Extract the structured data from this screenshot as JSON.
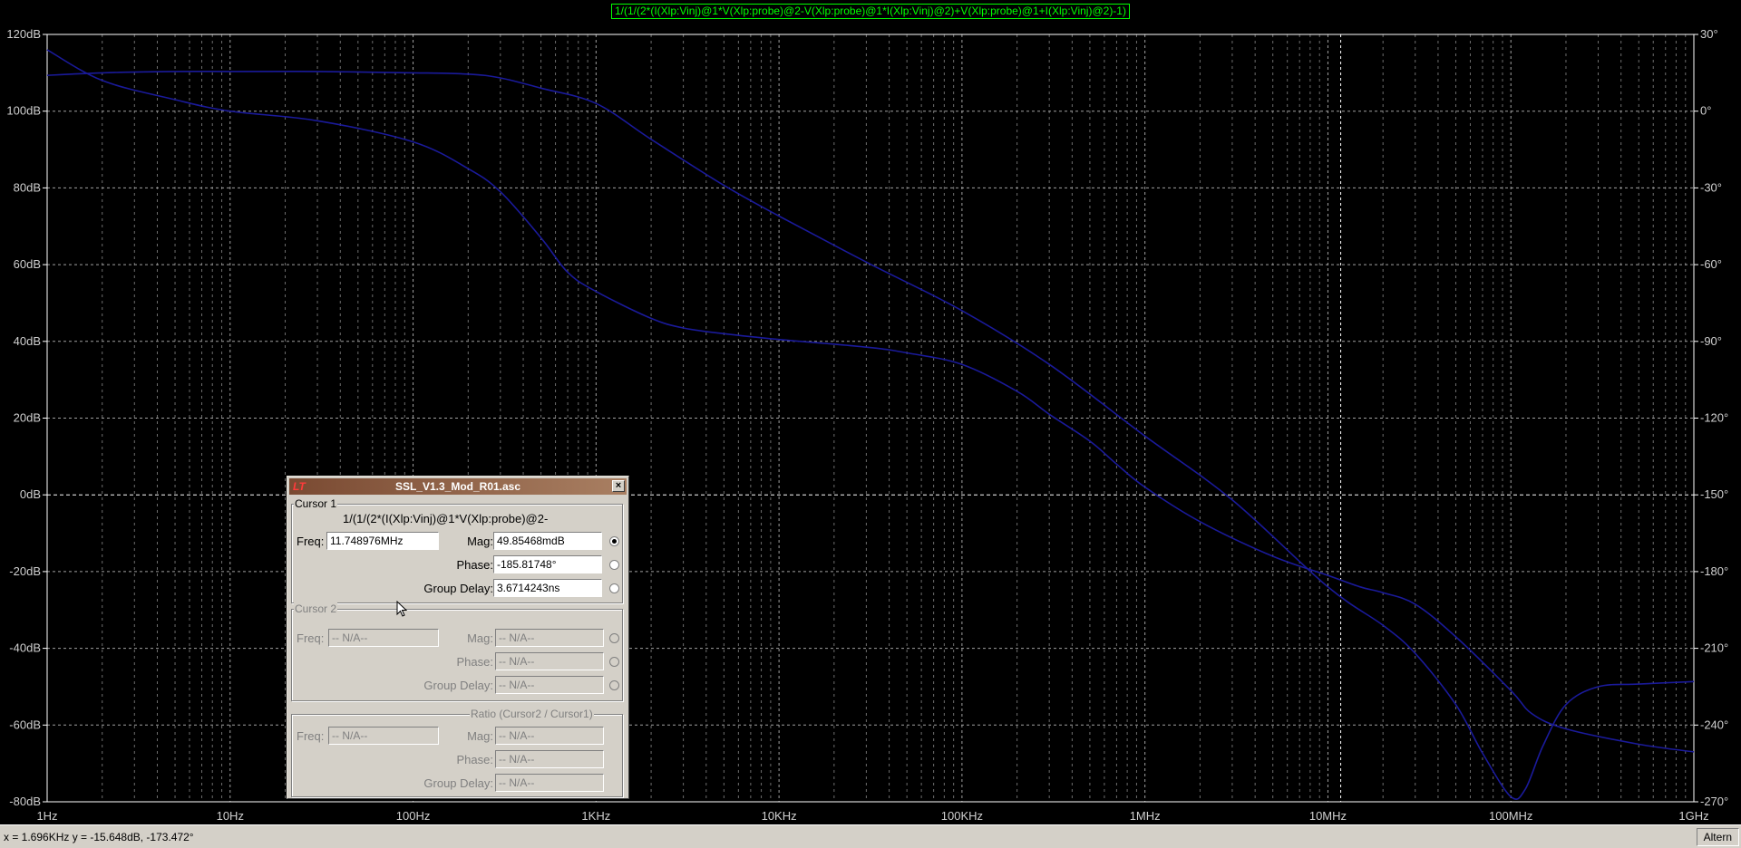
{
  "window": {
    "trace_expression": "1/(1/(2*(I(Xlp:Vinj)@1*V(Xlp:probe)@2-V(Xlp:probe)@1*I(Xlp:Vinj)@2)+V(Xlp:probe)@1+I(Xlp:Vinj)@2)-1)"
  },
  "chart_data": {
    "type": "line",
    "title": "1/(1/(2*(I(Xlp:Vinj)@1*V(Xlp:probe)@2-V(Xlp:probe)@1*I(Xlp:Vinj)@2)+V(Xlp:probe)@1+I(Xlp:Vinj)@2)-1)",
    "x_scale": "log",
    "xlim": [
      1,
      1000000000
    ],
    "x_ticks": [
      {
        "value": 1,
        "label": "1Hz"
      },
      {
        "value": 10,
        "label": "10Hz"
      },
      {
        "value": 100,
        "label": "100Hz"
      },
      {
        "value": 1000,
        "label": "1KHz"
      },
      {
        "value": 10000,
        "label": "10KHz"
      },
      {
        "value": 100000,
        "label": "100KHz"
      },
      {
        "value": 1000000,
        "label": "1MHz"
      },
      {
        "value": 10000000,
        "label": "10MHz"
      },
      {
        "value": 100000000,
        "label": "100MHz"
      },
      {
        "value": 1000000000,
        "label": "1GHz"
      }
    ],
    "ylim_left": [
      -80,
      120
    ],
    "y_ticks_left": [
      {
        "value": 120,
        "label": "120dB"
      },
      {
        "value": 100,
        "label": "100dB"
      },
      {
        "value": 80,
        "label": "80dB"
      },
      {
        "value": 60,
        "label": "60dB"
      },
      {
        "value": 40,
        "label": "40dB"
      },
      {
        "value": 20,
        "label": "20dB"
      },
      {
        "value": 0,
        "label": "0dB"
      },
      {
        "value": -20,
        "label": "-20dB"
      },
      {
        "value": -40,
        "label": "-40dB"
      },
      {
        "value": -60,
        "label": "-60dB"
      },
      {
        "value": -80,
        "label": "-80dB"
      }
    ],
    "ylim_right": [
      -270,
      30
    ],
    "y_ticks_right": [
      {
        "value": 30,
        "label": "30°"
      },
      {
        "value": 0,
        "label": "0°"
      },
      {
        "value": -30,
        "label": "-30°"
      },
      {
        "value": -60,
        "label": "-60°"
      },
      {
        "value": -90,
        "label": "-90°"
      },
      {
        "value": -120,
        "label": "-120°"
      },
      {
        "value": -150,
        "label": "-150°"
      },
      {
        "value": -180,
        "label": "-180°"
      },
      {
        "value": -210,
        "label": "-210°"
      },
      {
        "value": -240,
        "label": "-240°"
      },
      {
        "value": -270,
        "label": "-270°"
      }
    ],
    "grid": true,
    "zero_reference_y": 0,
    "cursor_x": 11748976,
    "series": [
      {
        "axis": "left",
        "color": "#1a1a9a",
        "x": [
          1,
          2,
          5,
          10,
          30,
          100,
          200,
          300,
          500,
          700,
          1000,
          2000,
          3000,
          5000,
          10000,
          30000,
          50000,
          100000,
          200000,
          300000,
          500000,
          700000,
          1000000,
          2000000,
          5000000,
          10000000,
          15000000,
          20000000,
          30000000,
          50000000,
          100000000,
          130000000,
          200000000,
          500000000,
          1000000000
        ],
        "y": [
          116,
          108,
          103,
          100,
          97.5,
          92,
          85,
          79,
          67,
          58,
          53,
          46,
          43.5,
          42,
          40.5,
          38.5,
          37,
          34,
          27,
          21,
          14,
          8,
          2,
          -7,
          -16,
          -21,
          -24,
          -25.5,
          -28.5,
          -37,
          -51,
          -57,
          -61,
          -65,
          -67
        ]
      },
      {
        "axis": "right",
        "color": "#1a1a9a",
        "x": [
          1,
          2,
          5,
          10,
          30,
          100,
          200,
          300,
          500,
          1000,
          2000,
          5000,
          10000,
          30000,
          100000,
          300000,
          1000000,
          3000000,
          10000000,
          20000000,
          30000000,
          50000000,
          70000000,
          100000000,
          120000000,
          150000000,
          200000000,
          300000000,
          500000000,
          1000000000
        ],
        "y": [
          14,
          15,
          15.5,
          15.5,
          15.5,
          15,
          14.5,
          13,
          9,
          3,
          -11,
          -29,
          -41,
          -59,
          -78,
          -99,
          -127,
          -152,
          -186,
          -201,
          -212,
          -232,
          -251,
          -268,
          -265,
          -248,
          -232,
          -225,
          -224,
          -223
        ]
      }
    ]
  },
  "dialog": {
    "title": "SSL_V1.3_Mod_R01.asc",
    "logo": "LT",
    "close_glyph": "×",
    "cursor1": {
      "legend": "Cursor 1",
      "trace_label": "1/(1/(2*(I(Xlp:Vinj)@1*V(Xlp:probe)@2-",
      "freq_label": "Freq:",
      "freq_value": "11.748976MHz",
      "mag_label": "Mag:",
      "mag_value": "49.85468mdB",
      "phase_label": "Phase:",
      "phase_value": "-185.81748°",
      "group_delay_label": "Group Delay:",
      "group_delay_value": "3.6714243ns"
    },
    "cursor2": {
      "legend": "Cursor 2",
      "freq_label": "Freq:",
      "freq_value": "-- N/A--",
      "mag_label": "Mag:",
      "mag_value": "-- N/A--",
      "phase_label": "Phase:",
      "phase_value": "-- N/A--",
      "group_delay_label": "Group Delay:",
      "group_delay_value": "-- N/A--"
    },
    "ratio": {
      "legend": "Ratio (Cursor2 / Cursor1)",
      "freq_label": "Freq:",
      "freq_value": "-- N/A--",
      "mag_label": "Mag:",
      "mag_value": "-- N/A--",
      "phase_label": "Phase:",
      "phase_value": "-- N/A--",
      "group_delay_label": "Group Delay:",
      "group_delay_value": "-- N/A--"
    }
  },
  "status": {
    "coords": "x = 1.696KHz     y = -15.648dB, -173.472°",
    "mode": "Altern"
  }
}
